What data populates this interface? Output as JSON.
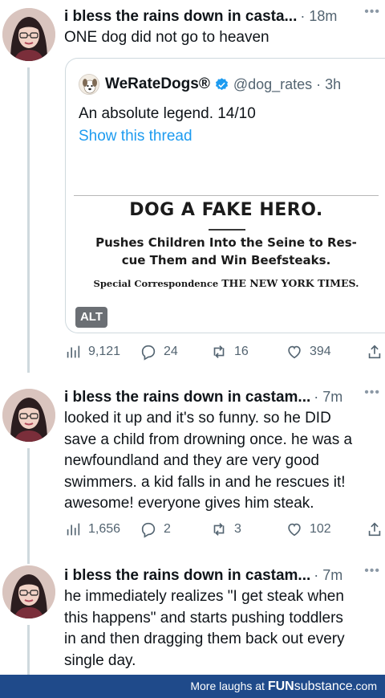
{
  "tweets": [
    {
      "author": "i bless the rains down in casta...",
      "time": "· 18m",
      "text": "ONE dog did not go to heaven",
      "quote": {
        "name": "WeRateDogs®",
        "handle": "@dog_rates · 3h",
        "text": "An absolute legend. 14/10",
        "link": "Show this thread",
        "clipping": {
          "headline": "DOG A FAKE HERO.",
          "subline1": "Pushes Children Into the Seine to Res-",
          "subline2": "cue Them and Win Beefsteaks.",
          "credit_prefix": "Special Correspondence",
          "credit_paper": "THE NEW YORK TIMES."
        },
        "alt_badge": "ALT"
      },
      "stats": {
        "views": "9,121",
        "replies": "24",
        "retweets": "16",
        "likes": "394"
      }
    },
    {
      "author": "i bless the rains down in castam...",
      "time": "· 7m",
      "lines": [
        "looked it up and it's so funny. so he DID",
        "save a child from drowning once. he was a",
        "newfoundland and they are very good",
        "swimmers. a kid falls in and he rescues it!",
        "awesome! everyone gives him steak."
      ],
      "stats": {
        "views": "1,656",
        "replies": "2",
        "retweets": "3",
        "likes": "102"
      }
    },
    {
      "author": "i bless the rains down in castam...",
      "time": "· 7m",
      "lines": [
        "he immediately realizes \"I get steak when",
        "this happens\" and starts pushing toddlers",
        "in and then dragging them back out every",
        "single day."
      ]
    }
  ],
  "footer": {
    "prefix": "More laughs at",
    "brand_bold": "FUN",
    "brand_rest": "substance",
    "suffix": ".com"
  },
  "colors": {
    "accent": "#1d9bf0",
    "muted": "#536471",
    "footer_bg": "#1f4a8a"
  }
}
